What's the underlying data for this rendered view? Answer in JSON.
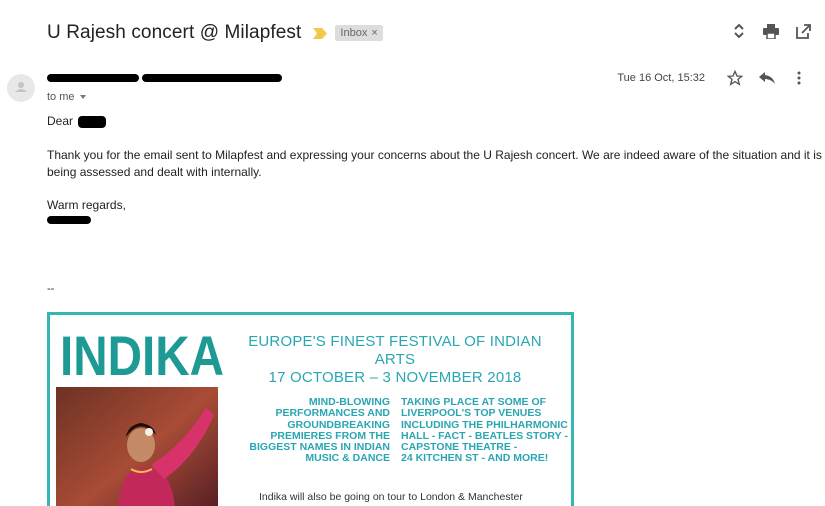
{
  "email": {
    "subject": "U Rajesh concert @ Milapfest",
    "label": "Inbox",
    "label_close": "×",
    "recipient_text": "to me",
    "date": "Tue 16 Oct, 15:32",
    "greeting": "Dear",
    "body_paragraph_1": "Thank you for the email sent to Milapfest and expressing your concerns about the U Rajesh concert.  We are indeed aware of the situation and it is",
    "body_paragraph_2": "being assessed and dealt with internally.",
    "signoff": "Warm regards,",
    "signature_separator": "--"
  },
  "icons": {
    "importance": "importance-marker-icon",
    "expand": "expand-collapse-icon",
    "print": "print-icon",
    "popout": "open-new-window-icon",
    "avatar": "person-avatar-icon",
    "star": "star-icon",
    "reply": "reply-icon",
    "more": "more-vertical-icon"
  },
  "banner": {
    "logo_text": "INDIKA",
    "headline_line1": "EUROPE'S FINEST FESTIVAL OF INDIAN ARTS",
    "headline_line2": "17 OCTOBER – 3 NOVEMBER 2018",
    "left_column": [
      "MIND-BLOWING",
      "PERFORMANCES AND",
      "GROUNDBREAKING",
      "PREMIERES FROM THE",
      "BIGGEST NAMES IN INDIAN",
      "MUSIC & DANCE"
    ],
    "right_column": [
      "TAKING PLACE AT SOME OF",
      "LIVERPOOL'S TOP VENUES",
      "INCLUDING THE PHILHARMONIC",
      "HALL - FACT - BEATLES STORY -",
      "CAPSTONE THEATRE -",
      "24 KITCHEN ST - AND MORE!"
    ],
    "tour_text": "Indika will also be going on tour to London & Manchester"
  },
  "colors": {
    "accent_teal": "#36b5b5",
    "banner_text": "#2aa6b3",
    "importance": "#f2c94c",
    "label_bg": "#dddddd"
  }
}
